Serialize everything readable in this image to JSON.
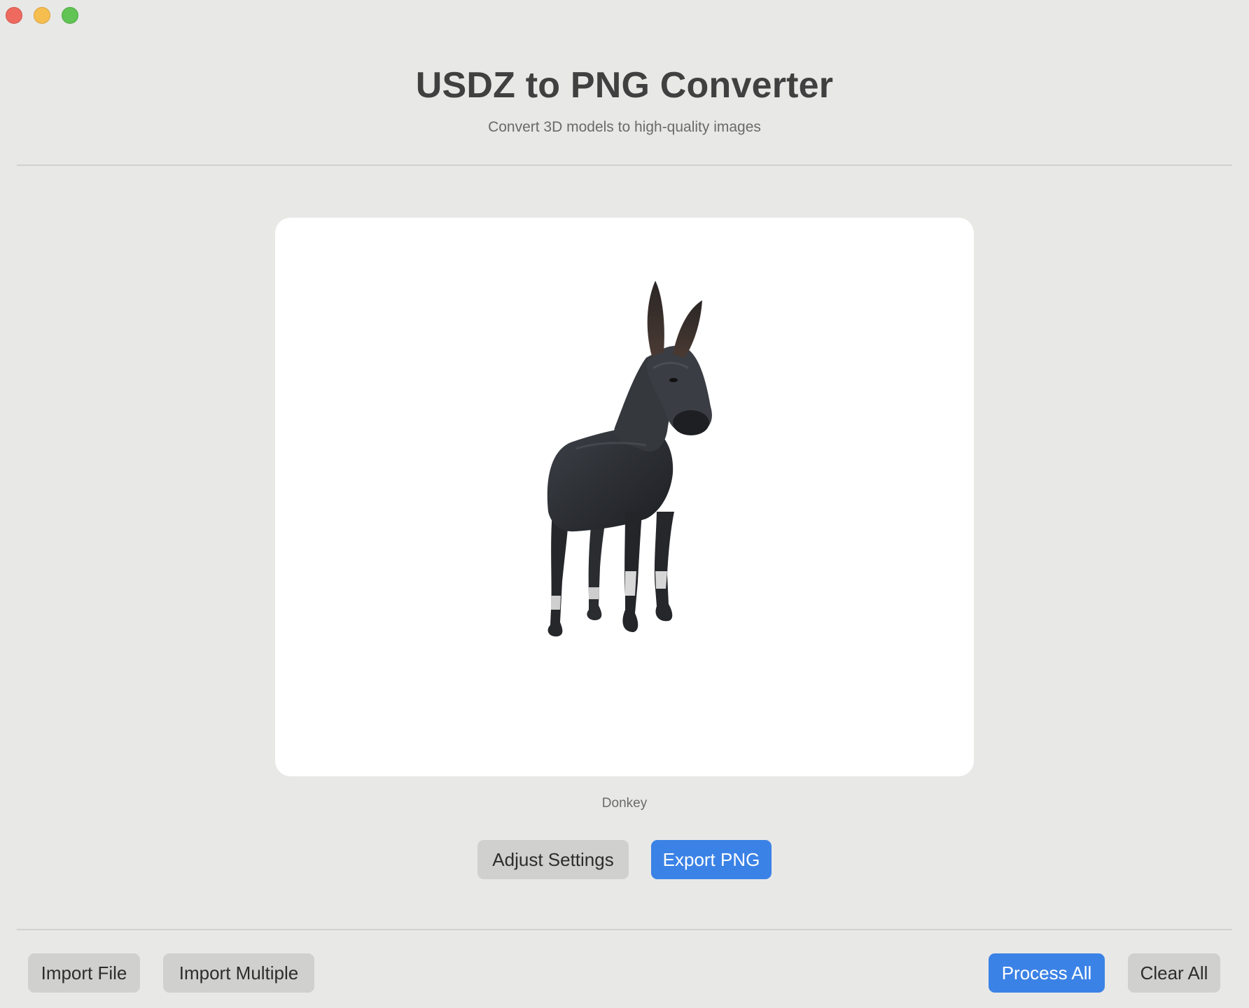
{
  "window": {
    "title_controls": [
      "close",
      "minimize",
      "zoom"
    ]
  },
  "header": {
    "title": "USDZ to PNG Converter",
    "subtitle": "Convert 3D models to high-quality images"
  },
  "preview": {
    "model_name": "Donkey",
    "image": "donkey-3d-model-render"
  },
  "actions": {
    "adjust_settings": "Adjust Settings",
    "export_png": "Export PNG"
  },
  "footer": {
    "import_file": "Import File",
    "import_multiple": "Import Multiple",
    "process_all": "Process All",
    "clear_all": "Clear All"
  },
  "colors": {
    "background": "#e8e8e7",
    "accent": "#3b82e6",
    "secondary_button": "#d0d0cf",
    "close": "#ee6a5e",
    "minimize": "#f5be4f",
    "zoom": "#61c454"
  }
}
